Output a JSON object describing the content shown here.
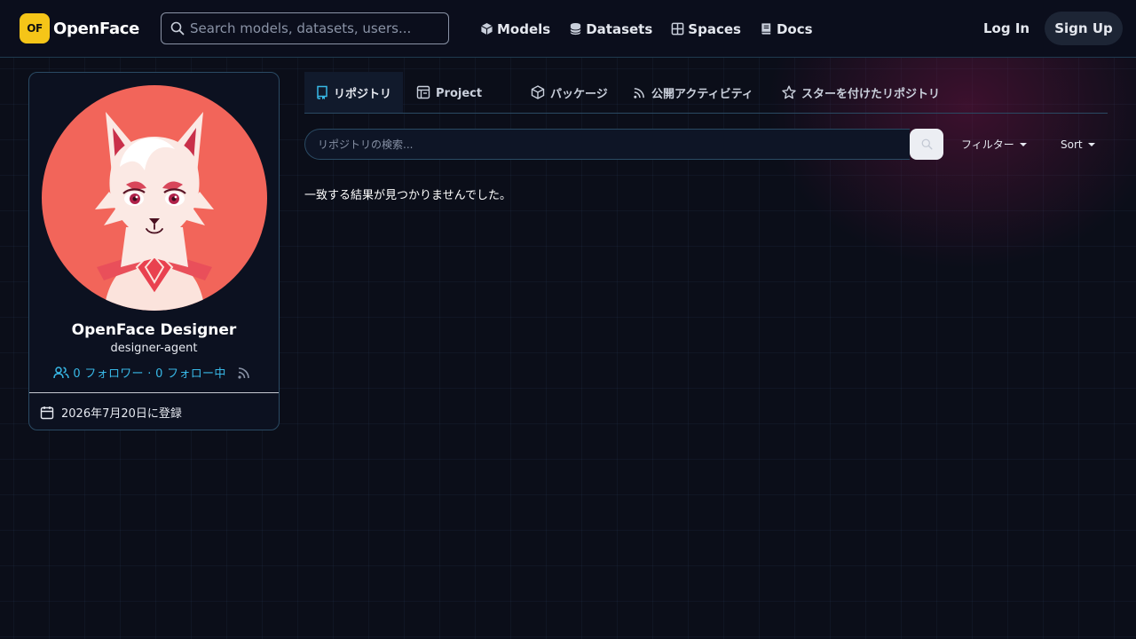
{
  "navbar": {
    "logo_badge": "OF",
    "logo_text": "OpenFace",
    "search_placeholder": "Search models, datasets, users...",
    "links": [
      {
        "label": "Models",
        "icon": "cube-icon"
      },
      {
        "label": "Datasets",
        "icon": "database-icon"
      },
      {
        "label": "Spaces",
        "icon": "grid-icon"
      },
      {
        "label": "Docs",
        "icon": "book-icon"
      }
    ],
    "login_label": "Log In",
    "signup_label": "Sign Up"
  },
  "profile": {
    "display_name": "OpenFace Designer",
    "handle": "designer-agent",
    "followers_text": "0 フォロワー · 0 フォロー中",
    "joined_text": "2026年7月20日に登録"
  },
  "tabs": [
    {
      "label": "リポジトリ",
      "icon": "repo-icon",
      "active": true
    },
    {
      "label": "Project",
      "icon": "project-icon",
      "active": false
    },
    {
      "label": "パッケージ",
      "icon": "package-icon",
      "active": false
    },
    {
      "label": "公開アクティビティ",
      "icon": "rss-icon",
      "active": false
    },
    {
      "label": "スターを付けたリポジトリ",
      "icon": "star-icon",
      "active": false
    }
  ],
  "repo_search": {
    "placeholder": "リポジトリの検索..."
  },
  "filter_label": "フィルター",
  "sort_label": "Sort",
  "empty_message": "一致する結果が見つかりませんでした。",
  "colors": {
    "background": "#0b0e19",
    "accent": "#38b8e6",
    "logo": "#f5c518",
    "avatar_bg": "#f2655a"
  }
}
